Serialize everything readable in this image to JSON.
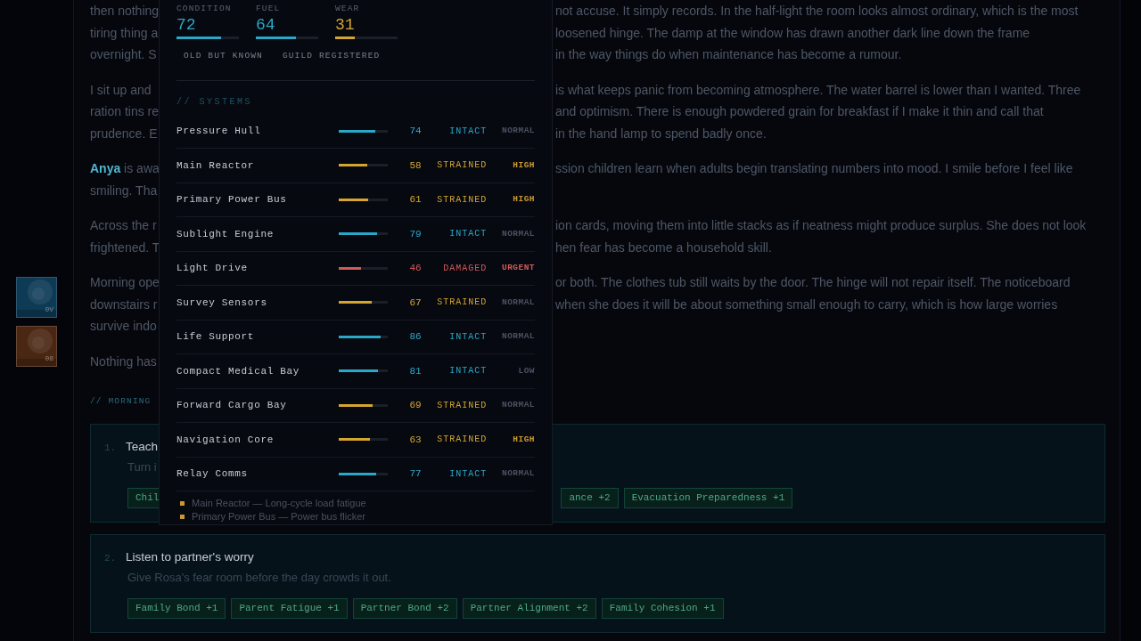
{
  "rail": [
    {
      "label": "0V",
      "color": "#0d3a55"
    },
    {
      "label": "08",
      "color": "#4a2712"
    }
  ],
  "story": [
    {
      "lines": [
        {
          "left": "then nothing",
          "right": "not accuse. It simply records. In the half-light the room looks almost ordinary, which is the most"
        },
        {
          "left": "tiring thing a",
          "right": "loosened hinge. The damp at the window has drawn another dark line down the frame"
        },
        {
          "left": "overnight. S",
          "right": "in the way things do when maintenance has become a rumour."
        }
      ]
    },
    {
      "lines": [
        {
          "left": "I sit up and",
          "right": "is what keeps panic from becoming atmosphere. The water barrel is lower than I wanted. Three"
        },
        {
          "left": "ration tins re",
          "right": "and optimism. There is enough powdered grain for breakfast if I make it thin and call that"
        },
        {
          "left": "prudence. E",
          "right": "in the hand lamp to spend badly once."
        }
      ]
    },
    {
      "lines": [
        {
          "left": "**Anya** is awa",
          "right": "ssion children learn when adults begin translating numbers into mood. I smile before I feel like"
        },
        {
          "left": "smiling. Tha"
        }
      ]
    },
    {
      "lines": [
        {
          "left": "Across the r",
          "right": "ion cards, moving them into little stacks as if neatness might produce surplus. She does not look"
        },
        {
          "left": "frightened. T",
          "right": "hen fear has become a household skill."
        }
      ]
    },
    {
      "lines": [
        {
          "left": "Morning ope",
          "right": "or both. The clothes tub still waits by the door. The hinge will not repair itself. The noticeboard"
        },
        {
          "left": "downstairs r",
          "right": "when she does it will be about something small enough to carry, which is how large worries"
        },
        {
          "left": "survive indo"
        }
      ]
    },
    {
      "lines": [
        {
          "left": "Nothing has"
        }
      ]
    }
  ],
  "section_label": "// MORNING",
  "tasks": [
    {
      "number": "1.",
      "title": "Teach",
      "description": "Turn i",
      "tags": [
        "Chil"
      ],
      "tags_after_panel": [
        "ance +2",
        "Evacuation Preparedness +1"
      ]
    },
    {
      "number": "2.",
      "title": "Listen to partner's worry",
      "description": "Give Rosa's fear room before the day crowds it out.",
      "tags": [
        "Family Bond +1",
        "Parent Fatigue +1",
        "Partner Bond +2",
        "Partner Alignment +2",
        "Family Cohesion +1"
      ]
    }
  ],
  "panel": {
    "stats": [
      {
        "label": "CONDITION",
        "value": "72",
        "level": 0.72,
        "color": "#2aa8c8"
      },
      {
        "label": "FUEL",
        "value": "64",
        "level": 0.64,
        "color": "#2aa8c8"
      },
      {
        "label": "WEAR",
        "value": "31",
        "level": 0.31,
        "color": "#d4a531"
      }
    ],
    "traits": [
      "OLD BUT KNOWN",
      "GUILD REGISTERED"
    ],
    "systems_title": "// SYSTEMS",
    "systems": [
      {
        "name": "Pressure Hull",
        "level": 0.74,
        "value": "74",
        "status": "INTACT",
        "color": "#2aa8c8",
        "priority": {
          "text": "NORMAL",
          "color": "#4a5160"
        }
      },
      {
        "name": "Main Reactor",
        "level": 0.58,
        "value": "58",
        "status": "STRAINED",
        "color": "#d4a531",
        "priority": {
          "text": "HIGH",
          "color": "#c9992e"
        }
      },
      {
        "name": "Primary Power Bus",
        "level": 0.61,
        "value": "61",
        "status": "STRAINED",
        "color": "#d4a531",
        "priority": {
          "text": "HIGH",
          "color": "#c9992e"
        }
      },
      {
        "name": "Sublight Engine",
        "level": 0.79,
        "value": "79",
        "status": "INTACT",
        "color": "#2aa8c8",
        "priority": {
          "text": "NORMAL",
          "color": "#4a5160"
        }
      },
      {
        "name": "Light Drive",
        "level": 0.46,
        "value": "46",
        "status": "DAMAGED",
        "color": "#d05a5a",
        "priority": {
          "text": "URGENT",
          "color": "#d05a5a"
        }
      },
      {
        "name": "Survey Sensors",
        "level": 0.67,
        "value": "67",
        "status": "STRAINED",
        "color": "#d4a531",
        "priority": {
          "text": "NORMAL",
          "color": "#4a5160"
        }
      },
      {
        "name": "Life Support",
        "level": 0.86,
        "value": "86",
        "status": "INTACT",
        "color": "#2aa8c8",
        "priority": {
          "text": "NORMAL",
          "color": "#4a5160"
        }
      },
      {
        "name": "Compact Medical Bay",
        "level": 0.81,
        "value": "81",
        "status": "INTACT",
        "color": "#2aa8c8",
        "priority": {
          "text": "LOW",
          "color": "#4a5160"
        }
      },
      {
        "name": "Forward Cargo Bay",
        "level": 0.69,
        "value": "69",
        "status": "STRAINED",
        "color": "#d4a531",
        "priority": {
          "text": "NORMAL",
          "color": "#4a5160"
        }
      },
      {
        "name": "Navigation Core",
        "level": 0.63,
        "value": "63",
        "status": "STRAINED",
        "color": "#d4a531",
        "priority": {
          "text": "HIGH",
          "color": "#c9992e"
        }
      },
      {
        "name": "Relay Comms",
        "level": 0.77,
        "value": "77",
        "status": "INTACT",
        "color": "#2aa8c8",
        "priority": {
          "text": "NORMAL",
          "color": "#4a5160"
        }
      }
    ],
    "notes": [
      "Main Reactor — Long-cycle load fatigue",
      "Primary Power Bus — Power bus flicker"
    ]
  }
}
